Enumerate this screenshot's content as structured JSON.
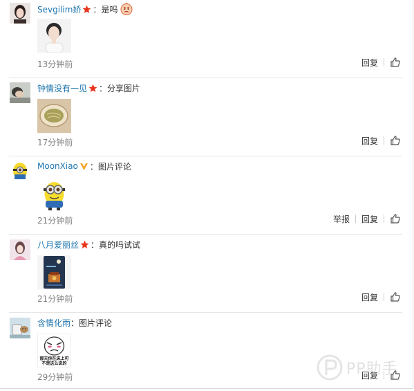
{
  "comments": [
    {
      "username": "Sevgilim娇",
      "badge": "red-star",
      "separator": "：",
      "text": "是吗",
      "time": "13分钟前",
      "actions": [
        "回复"
      ],
      "thumb": "portrait-photo",
      "avatar": "woman-portrait"
    },
    {
      "username": "钟情没有一见",
      "badge": "red-star",
      "separator": "：",
      "text": "分享图片",
      "time": "17分钟前",
      "actions": [
        "回复"
      ],
      "thumb": "noodle-bowl",
      "avatar": "sleeping-person"
    },
    {
      "username": "MoonXiao",
      "badge": "yellow-v",
      "separator": "：",
      "text": "图片评论",
      "time": "21分钟前",
      "actions": [
        "举报",
        "回复"
      ],
      "thumb": "minion",
      "avatar": "minion"
    },
    {
      "username": "八月爱丽丝",
      "badge": "red-star",
      "separator": "：",
      "text": "真的吗试试",
      "time": "21分钟前",
      "actions": [
        "回复"
      ],
      "thumb": "phone-screen",
      "avatar": "girl-pink"
    },
    {
      "username": "含情化雨",
      "badge": "",
      "separator": "：",
      "text": "图片评论",
      "time": "29分钟前",
      "actions": [
        "回复"
      ],
      "thumb": "meme-face",
      "thumb_caption": "那天你在床上可不是这么说的",
      "avatar": "cup-cat"
    }
  ],
  "watermark": "PP助手",
  "colors": {
    "username": "#1f76ad",
    "time": "#808080",
    "star": "#e8341c",
    "vbadge": "#f5a623"
  }
}
